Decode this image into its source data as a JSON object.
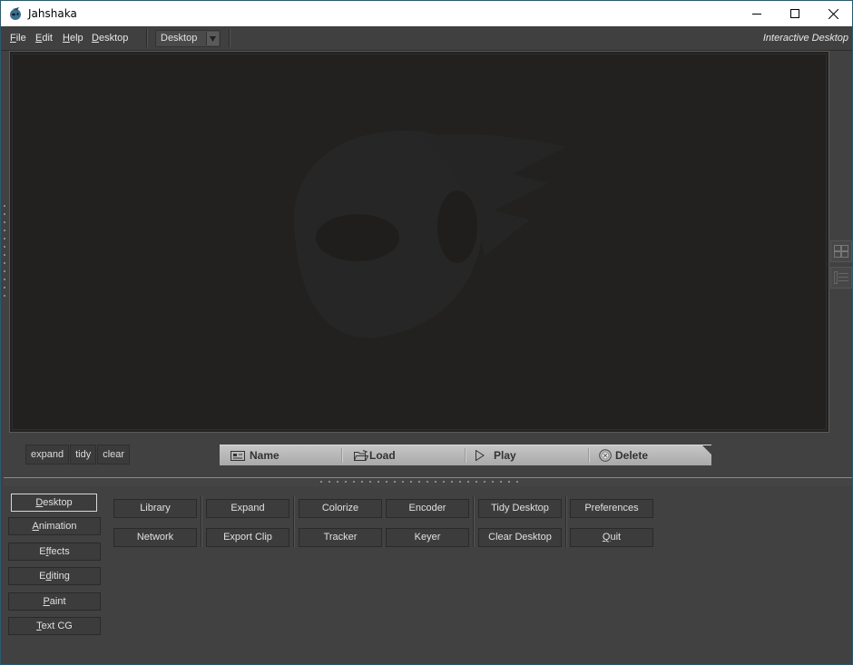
{
  "window": {
    "title": "Jahshaka",
    "controls": {
      "minimize": "minimize",
      "maximize": "maximize",
      "close": "close"
    }
  },
  "menubar": {
    "items": [
      {
        "label": "File",
        "mnemonic": "F"
      },
      {
        "label": "Edit",
        "mnemonic": "E"
      },
      {
        "label": "Help",
        "mnemonic": "H"
      },
      {
        "label": "Desktop",
        "mnemonic": "D"
      }
    ],
    "desktop_select": {
      "value": "Desktop"
    },
    "mode_label": "Interactive Desktop"
  },
  "desk_controls": {
    "buttons": [
      "expand",
      "tidy",
      "clear"
    ]
  },
  "clip_bar": {
    "buttons": [
      {
        "label": "Name",
        "icon": "name-tag-icon"
      },
      {
        "label": "Load",
        "icon": "folder-open-icon"
      },
      {
        "label": "Play",
        "icon": "play-icon"
      },
      {
        "label": "Delete",
        "icon": "delete-circle-icon"
      }
    ]
  },
  "side_tools": [
    {
      "icon": "grid-view-icon"
    },
    {
      "icon": "list-view-icon"
    }
  ],
  "categories": [
    {
      "label": "Desktop",
      "mnemonic": "D",
      "active": true
    },
    {
      "label": "Animation",
      "mnemonic": "A",
      "active": false
    },
    {
      "label": "Effects",
      "mnemonic": "f",
      "active": false
    },
    {
      "label": "Editing",
      "mnemonic": "d",
      "active": false
    },
    {
      "label": "Paint",
      "mnemonic": "P",
      "active": false
    },
    {
      "label": "Text CG",
      "mnemonic": "T",
      "active": false
    }
  ],
  "functions": {
    "col1": [
      "Library",
      "Network"
    ],
    "col2": [
      "Expand",
      "Export Clip"
    ],
    "col3": [
      "Colorize",
      "Tracker"
    ],
    "col4": [
      "Encoder",
      "Keyer"
    ],
    "col5": [
      "Tidy Desktop",
      "Clear Desktop"
    ],
    "col6": [
      "Preferences",
      "Quit"
    ]
  }
}
